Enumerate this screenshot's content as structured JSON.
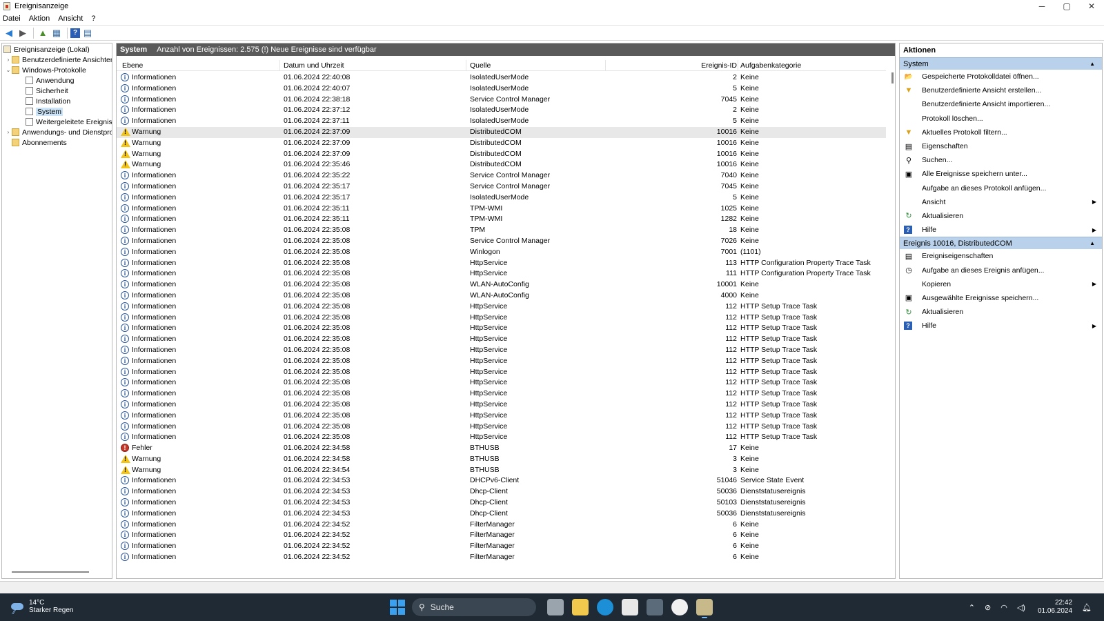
{
  "window": {
    "title": "Ereignisanzeige",
    "minimize": "─",
    "maximize": "▢",
    "close": "✕"
  },
  "menu": [
    "Datei",
    "Aktion",
    "Ansicht",
    "?"
  ],
  "toolbar": {
    "back": "◀",
    "forward": "▶",
    "up": "▲",
    "view": "▦",
    "help": "?",
    "pane": "▤"
  },
  "tree": {
    "root": "Ereignisanzeige (Lokal)",
    "custom_views": "Benutzerdefinierte Ansichten",
    "windows_logs": "Windows-Protokolle",
    "app": "Anwendung",
    "security": "Sicherheit",
    "setup": "Installation",
    "system": "System",
    "forwarded": "Weitergeleitete Ereignisse",
    "app_services": "Anwendungs- und Dienstprotokolle",
    "subscriptions": "Abonnements"
  },
  "center": {
    "title": "System",
    "summary": "Anzahl von Ereignissen: 2.575 (!) Neue Ereignisse sind verfügbar",
    "columns": {
      "level": "Ebene",
      "date": "Datum und Uhrzeit",
      "source": "Quelle",
      "id": "Ereignis-ID",
      "category": "Aufgabenkategorie"
    },
    "rows": [
      {
        "type": "info",
        "level": "Informationen",
        "date": "01.06.2024 22:40:08",
        "source": "IsolatedUserMode",
        "id": "2",
        "category": "Keine"
      },
      {
        "type": "info",
        "level": "Informationen",
        "date": "01.06.2024 22:40:07",
        "source": "IsolatedUserMode",
        "id": "5",
        "category": "Keine"
      },
      {
        "type": "info",
        "level": "Informationen",
        "date": "01.06.2024 22:38:18",
        "source": "Service Control Manager",
        "id": "7045",
        "category": "Keine"
      },
      {
        "type": "info",
        "level": "Informationen",
        "date": "01.06.2024 22:37:12",
        "source": "IsolatedUserMode",
        "id": "2",
        "category": "Keine"
      },
      {
        "type": "info",
        "level": "Informationen",
        "date": "01.06.2024 22:37:11",
        "source": "IsolatedUserMode",
        "id": "5",
        "category": "Keine"
      },
      {
        "type": "warn",
        "level": "Warnung",
        "date": "01.06.2024 22:37:09",
        "source": "DistributedCOM",
        "id": "10016",
        "category": "Keine",
        "selected": true
      },
      {
        "type": "warn",
        "level": "Warnung",
        "date": "01.06.2024 22:37:09",
        "source": "DistributedCOM",
        "id": "10016",
        "category": "Keine"
      },
      {
        "type": "warn",
        "level": "Warnung",
        "date": "01.06.2024 22:37:09",
        "source": "DistributedCOM",
        "id": "10016",
        "category": "Keine"
      },
      {
        "type": "warn",
        "level": "Warnung",
        "date": "01.06.2024 22:35:46",
        "source": "DistributedCOM",
        "id": "10016",
        "category": "Keine"
      },
      {
        "type": "info",
        "level": "Informationen",
        "date": "01.06.2024 22:35:22",
        "source": "Service Control Manager",
        "id": "7040",
        "category": "Keine"
      },
      {
        "type": "info",
        "level": "Informationen",
        "date": "01.06.2024 22:35:17",
        "source": "Service Control Manager",
        "id": "7045",
        "category": "Keine"
      },
      {
        "type": "info",
        "level": "Informationen",
        "date": "01.06.2024 22:35:17",
        "source": "IsolatedUserMode",
        "id": "5",
        "category": "Keine"
      },
      {
        "type": "info",
        "level": "Informationen",
        "date": "01.06.2024 22:35:11",
        "source": "TPM-WMI",
        "id": "1025",
        "category": "Keine"
      },
      {
        "type": "info",
        "level": "Informationen",
        "date": "01.06.2024 22:35:11",
        "source": "TPM-WMI",
        "id": "1282",
        "category": "Keine"
      },
      {
        "type": "info",
        "level": "Informationen",
        "date": "01.06.2024 22:35:08",
        "source": "TPM",
        "id": "18",
        "category": "Keine"
      },
      {
        "type": "info",
        "level": "Informationen",
        "date": "01.06.2024 22:35:08",
        "source": "Service Control Manager",
        "id": "7026",
        "category": "Keine"
      },
      {
        "type": "info",
        "level": "Informationen",
        "date": "01.06.2024 22:35:08",
        "source": "Winlogon",
        "id": "7001",
        "category": "(1101)"
      },
      {
        "type": "info",
        "level": "Informationen",
        "date": "01.06.2024 22:35:08",
        "source": "HttpService",
        "id": "113",
        "category": "HTTP Configuration Property Trace Task"
      },
      {
        "type": "info",
        "level": "Informationen",
        "date": "01.06.2024 22:35:08",
        "source": "HttpService",
        "id": "111",
        "category": "HTTP Configuration Property Trace Task"
      },
      {
        "type": "info",
        "level": "Informationen",
        "date": "01.06.2024 22:35:08",
        "source": "WLAN-AutoConfig",
        "id": "10001",
        "category": "Keine"
      },
      {
        "type": "info",
        "level": "Informationen",
        "date": "01.06.2024 22:35:08",
        "source": "WLAN-AutoConfig",
        "id": "4000",
        "category": "Keine"
      },
      {
        "type": "info",
        "level": "Informationen",
        "date": "01.06.2024 22:35:08",
        "source": "HttpService",
        "id": "112",
        "category": "HTTP Setup Trace Task"
      },
      {
        "type": "info",
        "level": "Informationen",
        "date": "01.06.2024 22:35:08",
        "source": "HttpService",
        "id": "112",
        "category": "HTTP Setup Trace Task"
      },
      {
        "type": "info",
        "level": "Informationen",
        "date": "01.06.2024 22:35:08",
        "source": "HttpService",
        "id": "112",
        "category": "HTTP Setup Trace Task"
      },
      {
        "type": "info",
        "level": "Informationen",
        "date": "01.06.2024 22:35:08",
        "source": "HttpService",
        "id": "112",
        "category": "HTTP Setup Trace Task"
      },
      {
        "type": "info",
        "level": "Informationen",
        "date": "01.06.2024 22:35:08",
        "source": "HttpService",
        "id": "112",
        "category": "HTTP Setup Trace Task"
      },
      {
        "type": "info",
        "level": "Informationen",
        "date": "01.06.2024 22:35:08",
        "source": "HttpService",
        "id": "112",
        "category": "HTTP Setup Trace Task"
      },
      {
        "type": "info",
        "level": "Informationen",
        "date": "01.06.2024 22:35:08",
        "source": "HttpService",
        "id": "112",
        "category": "HTTP Setup Trace Task"
      },
      {
        "type": "info",
        "level": "Informationen",
        "date": "01.06.2024 22:35:08",
        "source": "HttpService",
        "id": "112",
        "category": "HTTP Setup Trace Task"
      },
      {
        "type": "info",
        "level": "Informationen",
        "date": "01.06.2024 22:35:08",
        "source": "HttpService",
        "id": "112",
        "category": "HTTP Setup Trace Task"
      },
      {
        "type": "info",
        "level": "Informationen",
        "date": "01.06.2024 22:35:08",
        "source": "HttpService",
        "id": "112",
        "category": "HTTP Setup Trace Task"
      },
      {
        "type": "info",
        "level": "Informationen",
        "date": "01.06.2024 22:35:08",
        "source": "HttpService",
        "id": "112",
        "category": "HTTP Setup Trace Task"
      },
      {
        "type": "info",
        "level": "Informationen",
        "date": "01.06.2024 22:35:08",
        "source": "HttpService",
        "id": "112",
        "category": "HTTP Setup Trace Task"
      },
      {
        "type": "info",
        "level": "Informationen",
        "date": "01.06.2024 22:35:08",
        "source": "HttpService",
        "id": "112",
        "category": "HTTP Setup Trace Task"
      },
      {
        "type": "err",
        "level": "Fehler",
        "date": "01.06.2024 22:34:58",
        "source": "BTHUSB",
        "id": "17",
        "category": "Keine"
      },
      {
        "type": "warn",
        "level": "Warnung",
        "date": "01.06.2024 22:34:58",
        "source": "BTHUSB",
        "id": "3",
        "category": "Keine"
      },
      {
        "type": "warn",
        "level": "Warnung",
        "date": "01.06.2024 22:34:54",
        "source": "BTHUSB",
        "id": "3",
        "category": "Keine"
      },
      {
        "type": "info",
        "level": "Informationen",
        "date": "01.06.2024 22:34:53",
        "source": "DHCPv6-Client",
        "id": "51046",
        "category": "Service State Event"
      },
      {
        "type": "info",
        "level": "Informationen",
        "date": "01.06.2024 22:34:53",
        "source": "Dhcp-Client",
        "id": "50036",
        "category": "Dienststatusereignis"
      },
      {
        "type": "info",
        "level": "Informationen",
        "date": "01.06.2024 22:34:53",
        "source": "Dhcp-Client",
        "id": "50103",
        "category": "Dienststatusereignis"
      },
      {
        "type": "info",
        "level": "Informationen",
        "date": "01.06.2024 22:34:53",
        "source": "Dhcp-Client",
        "id": "50036",
        "category": "Dienststatusereignis"
      },
      {
        "type": "info",
        "level": "Informationen",
        "date": "01.06.2024 22:34:52",
        "source": "FilterManager",
        "id": "6",
        "category": "Keine"
      },
      {
        "type": "info",
        "level": "Informationen",
        "date": "01.06.2024 22:34:52",
        "source": "FilterManager",
        "id": "6",
        "category": "Keine"
      },
      {
        "type": "info",
        "level": "Informationen",
        "date": "01.06.2024 22:34:52",
        "source": "FilterManager",
        "id": "6",
        "category": "Keine"
      },
      {
        "type": "info",
        "level": "Informationen",
        "date": "01.06.2024 22:34:52",
        "source": "FilterManager",
        "id": "6",
        "category": "Keine"
      }
    ]
  },
  "actions": {
    "title": "Aktionen",
    "section1": "System",
    "items1": [
      {
        "icon": "open-log-icon",
        "glyph": "📂",
        "label": "Gespeicherte Protokolldatei öffnen..."
      },
      {
        "icon": "filter-icon",
        "glyph": "▼",
        "label": "Benutzerdefinierte Ansicht erstellen..."
      },
      {
        "icon": "",
        "glyph": "",
        "label": "Benutzerdefinierte Ansicht importieren..."
      },
      {
        "icon": "",
        "glyph": "",
        "label": "Protokoll löschen..."
      },
      {
        "icon": "filter-icon",
        "glyph": "▼",
        "label": "Aktuelles Protokoll filtern..."
      },
      {
        "icon": "properties-icon",
        "glyph": "▤",
        "label": "Eigenschaften"
      },
      {
        "icon": "binoculars-icon",
        "glyph": "⚲",
        "label": "Suchen..."
      },
      {
        "icon": "save-icon",
        "glyph": "▣",
        "label": "Alle Ereignisse speichern unter..."
      },
      {
        "icon": "",
        "glyph": "",
        "label": "Aufgabe an dieses Protokoll anfügen..."
      },
      {
        "icon": "",
        "glyph": "",
        "label": "Ansicht",
        "submenu": true
      },
      {
        "icon": "refresh-icon",
        "glyph": "↻",
        "label": "Aktualisieren"
      },
      {
        "icon": "help-icon",
        "glyph": "?",
        "label": "Hilfe",
        "submenu": true
      }
    ],
    "section2": "Ereignis 10016, DistributedCOM",
    "items2": [
      {
        "icon": "event-properties-icon",
        "glyph": "▤",
        "label": "Ereigniseigenschaften"
      },
      {
        "icon": "task-icon",
        "glyph": "◷",
        "label": "Aufgabe an dieses Ereignis anfügen..."
      },
      {
        "icon": "",
        "glyph": "",
        "label": "Kopieren",
        "submenu": true
      },
      {
        "icon": "save-icon",
        "glyph": "▣",
        "label": "Ausgewählte Ereignisse speichern..."
      },
      {
        "icon": "refresh-icon",
        "glyph": "↻",
        "label": "Aktualisieren"
      },
      {
        "icon": "help-icon",
        "glyph": "?",
        "label": "Hilfe",
        "submenu": true
      }
    ]
  },
  "taskbar": {
    "temp": "14°C",
    "weather": "Starker Regen",
    "search": "Suche",
    "time": "22:42",
    "date": "01.06.2024"
  }
}
